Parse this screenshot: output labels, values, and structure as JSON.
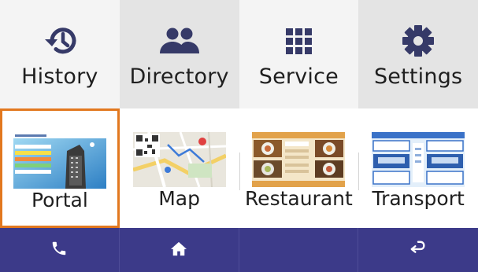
{
  "top_menu": [
    {
      "label": "History",
      "icon": "history-icon"
    },
    {
      "label": "Directory",
      "icon": "people-icon"
    },
    {
      "label": "Service",
      "icon": "grid-icon"
    },
    {
      "label": "Settings",
      "icon": "gear-icon"
    }
  ],
  "tiles": [
    {
      "label": "Portal",
      "thumb": "portal-thumbnail",
      "selected": true
    },
    {
      "label": "Map",
      "thumb": "map-thumbnail",
      "selected": false
    },
    {
      "label": "Restaurant",
      "thumb": "restaurant-thumbnail",
      "selected": false
    },
    {
      "label": "Transport",
      "thumb": "transport-thumbnail",
      "selected": false
    }
  ],
  "bottom_bar": [
    {
      "icon": "phone-icon"
    },
    {
      "icon": "home-icon"
    },
    {
      "icon": ""
    },
    {
      "icon": "back-icon"
    }
  ],
  "colors": {
    "accent_border": "#e2781f",
    "bottom_bar": "#3c3a89",
    "icon_navy": "#3a3f6b"
  }
}
